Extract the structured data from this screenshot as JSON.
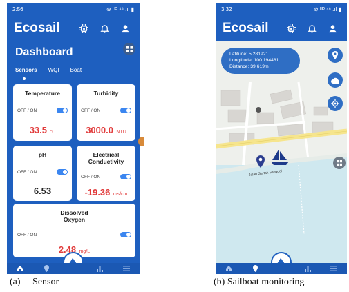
{
  "phone_a": {
    "status_time": "2:56",
    "status_right": "⊚ ᴴᴰ ⁴⁶ .ıl ▮",
    "app_title": "Ecosail",
    "dashboard_title": "Dashboard",
    "tabs": [
      {
        "label": "Sensors",
        "active": true
      },
      {
        "label": "WQI",
        "active": false
      },
      {
        "label": "Boat",
        "active": false
      }
    ],
    "cards": [
      {
        "title": "Temperature",
        "toggle_label": "OFF / ON",
        "value": "33.5",
        "unit": "°C",
        "color": "#e13b3b"
      },
      {
        "title": "Turbidity",
        "toggle_label": "OFF / ON",
        "value": "3000.0",
        "unit": "NTU",
        "color": "#e13b3b"
      },
      {
        "title": "pH",
        "toggle_label": "OFF / ON",
        "value": "6.53",
        "unit": "",
        "color": "#222222"
      },
      {
        "title_line1": "Electrical",
        "title_line2": "Conductivity",
        "toggle_label": "OFF / ON",
        "value": "-19.36",
        "unit": "ms/cm",
        "color": "#e13b3b"
      },
      {
        "title_line1": "Dissolved",
        "title_line2": "Oxygen",
        "toggle_label": "OFF / ON",
        "value": "2.48",
        "unit": "mg/L",
        "color": "#e13b3b"
      }
    ],
    "nav_icons": [
      "home-icon",
      "location-pin-icon",
      "sailboat-icon",
      "bar-chart-icon",
      "menu-icon"
    ]
  },
  "phone_b": {
    "status_time": "3:32",
    "status_right": "⊚ ᴴᴰ ⁴⁶ .ıl ▮",
    "app_title": "Ecosail",
    "info": {
      "latitude": "Latitude: 5.281921",
      "longitude": "Longtitude: 100.194481",
      "distance": "Distance: 39.619m"
    },
    "road_label": "Jalan Gertak Sanggol",
    "nav_icons": [
      "home-icon",
      "location-pin-icon",
      "sailboat-icon",
      "bar-chart-icon",
      "menu-icon"
    ]
  },
  "captions": {
    "a": "(a)     Sensor",
    "b": "(b) Sailboat monitoring"
  },
  "colors": {
    "primary_blue": "#1e5fbf",
    "accent_red": "#e13b3b",
    "toggle_blue": "#3b86f0",
    "water": "#cfe8ef",
    "land": "#eef0ec"
  }
}
